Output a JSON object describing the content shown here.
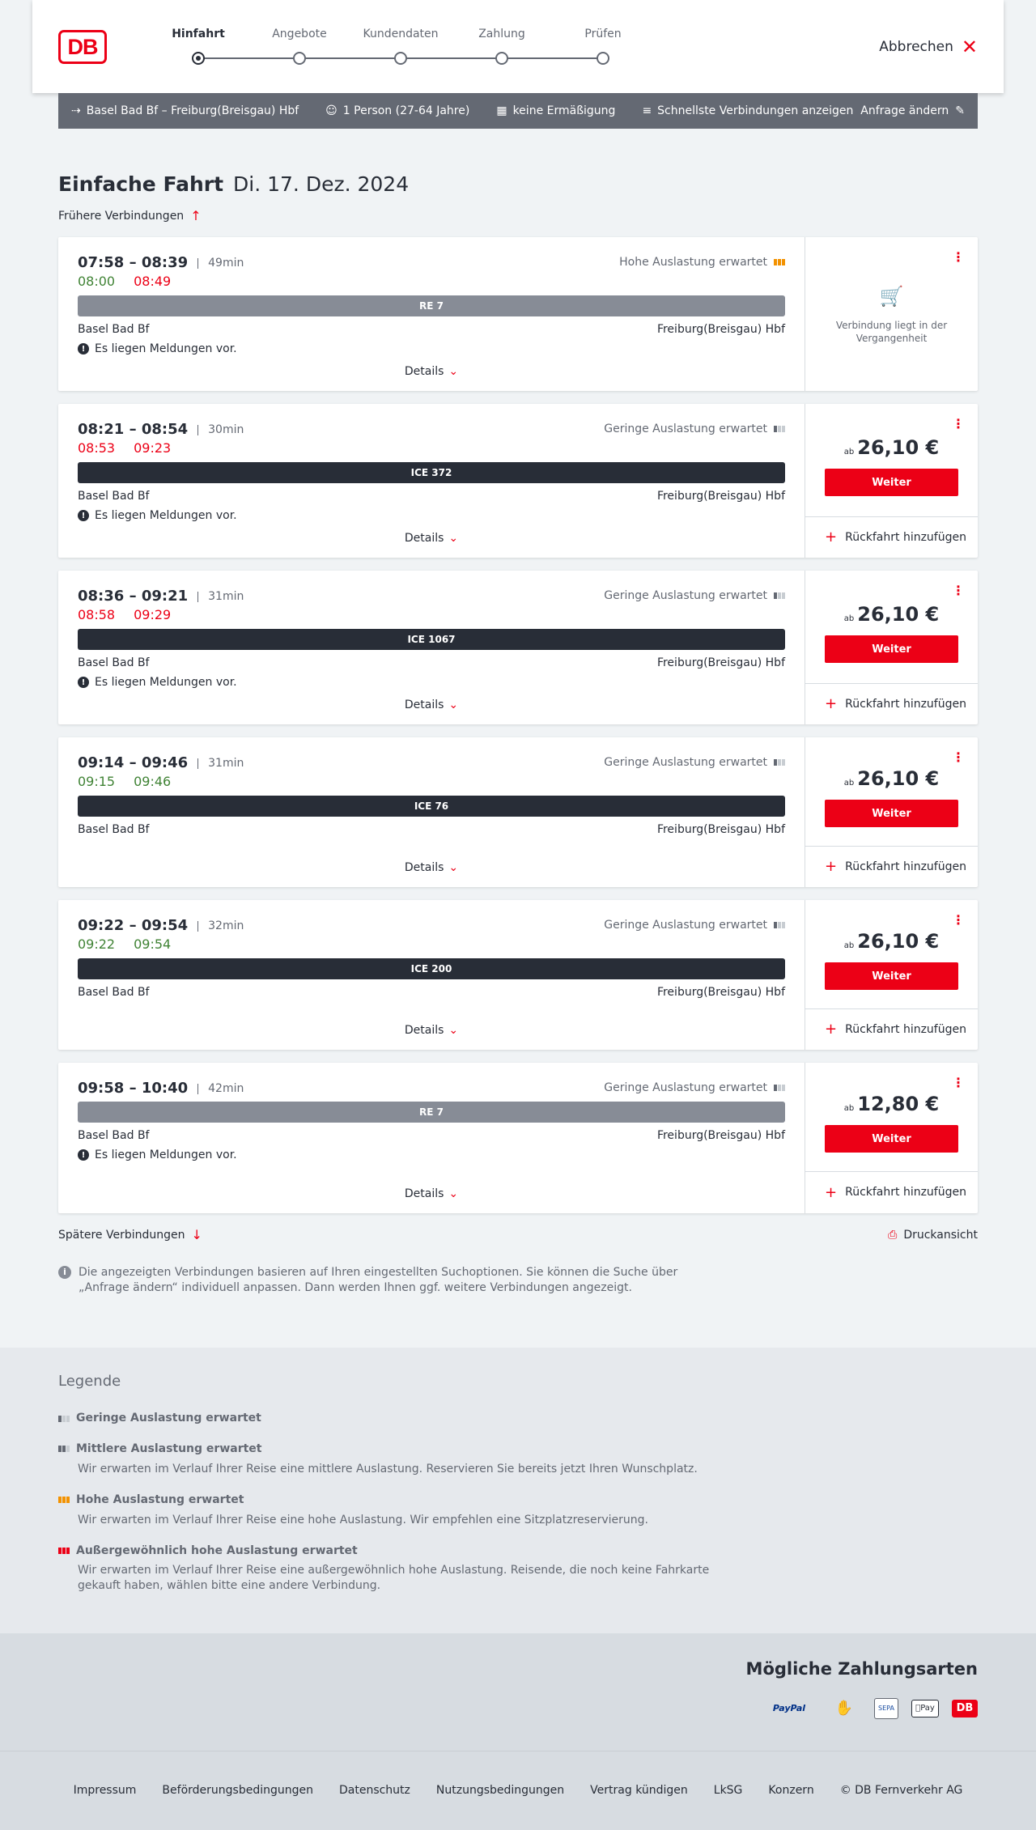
{
  "header": {
    "logo": "DB",
    "steps": [
      "Hinfahrt",
      "Angebote",
      "Kundendaten",
      "Zahlung",
      "Prüfen"
    ],
    "active_step": 0,
    "cancel_label": "Abbrechen"
  },
  "query": {
    "route": "Basel Bad Bf – Freiburg(Breisgau) Hbf",
    "passengers": "1 Person (27-64 Jahre)",
    "discount": "keine Ermäßigung",
    "fastest": "Schnellste Verbindungen anzeigen",
    "edit_label": "Anfrage ändern"
  },
  "page": {
    "title": "Einfache Fahrt",
    "date": "Di. 17. Dez. 2024",
    "earlier_label": "Frühere Verbindungen",
    "later_label": "Spätere Verbindungen",
    "print_label": "Druckansicht",
    "info_text": "Die angezeigten Verbindungen basieren auf Ihren eingestellten Suchoptionen. Sie können die Suche über „Anfrage ändern“ individuell anpassen. Dann werden Ihnen ggf. weitere Verbindungen angezeigt."
  },
  "labels": {
    "details": "Details",
    "weiter": "Weiter",
    "ab": "ab",
    "ruckfahrt": "Rückfahrt hinzufügen",
    "past": "Verbindung liegt in der Vergangenheit",
    "message": "Es liegen Meldungen vor."
  },
  "connections": [
    {
      "time": "07:58 – 08:39",
      "duration": "49min",
      "rt_dep": "08:00",
      "rt_arr": "08:49",
      "rt_dep_status": "ontime",
      "rt_arr_status": "delayed",
      "load": "Hohe Auslastung erwartet",
      "load_level": "high",
      "train": "RE 7",
      "train_style": "grey",
      "from": "Basel Bad Bf",
      "to": "Freiburg(Breisgau) Hbf",
      "has_message": true,
      "past": true
    },
    {
      "time": "08:21 – 08:54",
      "duration": "30min",
      "rt_dep": "08:53",
      "rt_arr": "09:23",
      "rt_dep_status": "delayed",
      "rt_arr_status": "delayed",
      "load": "Geringe Auslastung erwartet",
      "load_level": "low",
      "train": "ICE 372",
      "train_style": "dark",
      "from": "Basel Bad Bf",
      "to": "Freiburg(Breisgau) Hbf",
      "has_message": true,
      "price": "26,10 €"
    },
    {
      "time": "08:36 – 09:21",
      "duration": "31min",
      "rt_dep": "08:58",
      "rt_arr": "09:29",
      "rt_dep_status": "delayed",
      "rt_arr_status": "delayed",
      "load": "Geringe Auslastung erwartet",
      "load_level": "low",
      "train": "ICE 1067",
      "train_style": "dark",
      "from": "Basel Bad Bf",
      "to": "Freiburg(Breisgau) Hbf",
      "has_message": true,
      "price": "26,10 €"
    },
    {
      "time": "09:14 – 09:46",
      "duration": "31min",
      "rt_dep": "09:15",
      "rt_arr": "09:46",
      "rt_dep_status": "ontime",
      "rt_arr_status": "ontime",
      "load": "Geringe Auslastung erwartet",
      "load_level": "low",
      "train": "ICE 76",
      "train_style": "dark",
      "from": "Basel Bad Bf",
      "to": "Freiburg(Breisgau) Hbf",
      "has_message": false,
      "price": "26,10 €"
    },
    {
      "time": "09:22 – 09:54",
      "duration": "32min",
      "rt_dep": "09:22",
      "rt_arr": "09:54",
      "rt_dep_status": "ontime",
      "rt_arr_status": "ontime",
      "load": "Geringe Auslastung erwartet",
      "load_level": "low",
      "train": "ICE 200",
      "train_style": "dark",
      "from": "Basel Bad Bf",
      "to": "Freiburg(Breisgau) Hbf",
      "has_message": false,
      "price": "26,10 €"
    },
    {
      "time": "09:58 – 10:40",
      "duration": "42min",
      "rt_dep": "",
      "rt_arr": "",
      "load": "Geringe Auslastung erwartet",
      "load_level": "low",
      "train": "RE 7",
      "train_style": "grey",
      "from": "Basel Bad Bf",
      "to": "Freiburg(Breisgau) Hbf",
      "has_message": true,
      "price": "12,80 €"
    }
  ],
  "legend": {
    "title": "Legende",
    "items": [
      {
        "title": "Geringe Auslastung erwartet",
        "level": "low",
        "desc": ""
      },
      {
        "title": "Mittlere Auslastung erwartet",
        "level": "mid",
        "desc": "Wir erwarten im Verlauf Ihrer Reise eine mittlere Auslastung. Reservieren Sie bereits jetzt Ihren Wunschplatz."
      },
      {
        "title": "Hohe Auslastung erwartet",
        "level": "high",
        "desc": "Wir erwarten im Verlauf Ihrer Reise eine hohe Auslastung. Wir empfehlen eine Sitzplatzreservierung."
      },
      {
        "title": "Außergewöhnlich hohe Auslastung erwartet",
        "level": "extreme",
        "desc": "Wir erwarten im Verlauf Ihrer Reise eine außergewöhnlich hohe Auslastung. Reisende, die noch keine Fahrkarte gekauft haben, wählen bitte eine andere Verbindung."
      }
    ]
  },
  "payment": {
    "title": "Mögliche Zahlungsarten",
    "methods": [
      "PayPal",
      "SEPA",
      "Pay",
      "DB"
    ]
  },
  "footer": {
    "links": [
      "Impressum",
      "Beförderungsbedingungen",
      "Datenschutz",
      "Nutzungsbedingungen",
      "Vertrag kündigen",
      "LkSG",
      "Konzern",
      "© DB Fernverkehr AG"
    ]
  },
  "colors": {
    "accent": "#ec0016",
    "ontime": "#408335",
    "dark": "#282d37",
    "grey_bar": "#878c96",
    "load_high": "#f39200"
  }
}
